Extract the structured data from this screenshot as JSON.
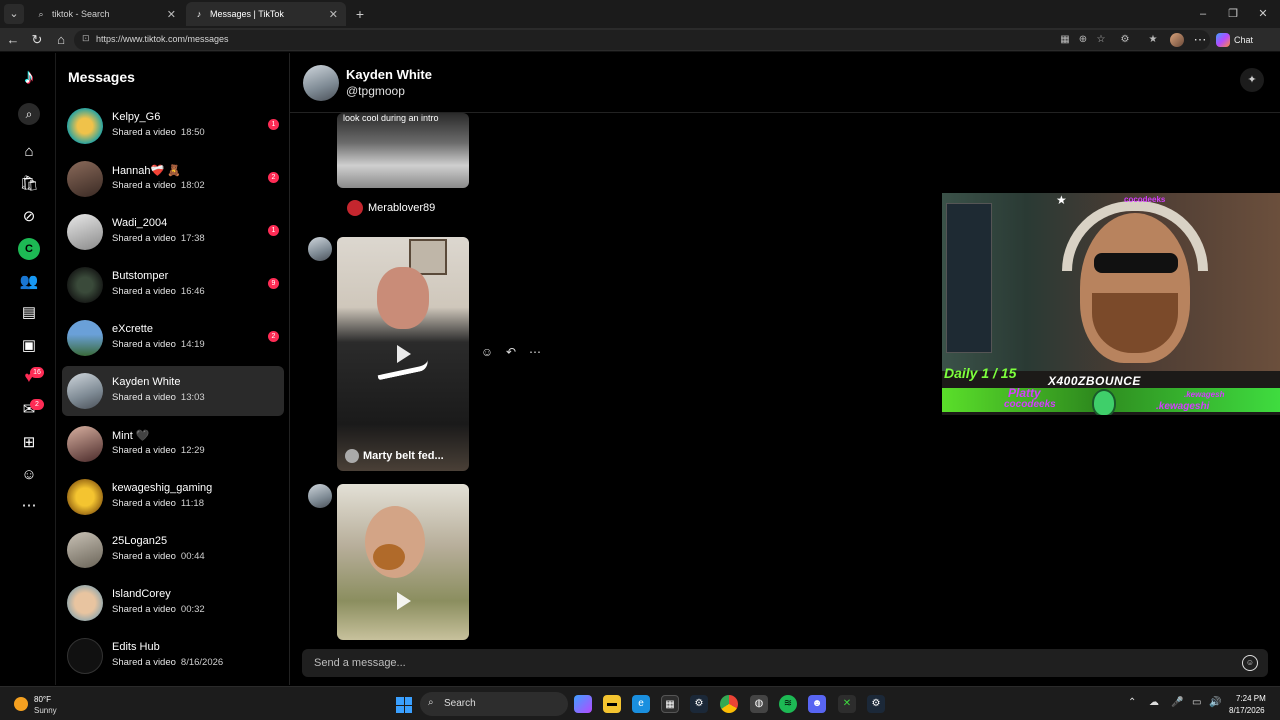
{
  "browser": {
    "tabs": [
      {
        "label": "tiktok - Search",
        "favicon": "search-icon"
      },
      {
        "label": "Messages | TikTok",
        "favicon": "tiktok-icon"
      }
    ],
    "url": "https://www.tiktok.com/messages",
    "chat_label": "Chat"
  },
  "rail": {
    "badges": {
      "activity": "16",
      "inbox": "2"
    }
  },
  "messages": {
    "title": "Messages",
    "conversations": [
      {
        "name": "Kelpy_G6",
        "preview": "Shared a video",
        "time": "18:50",
        "unread": "1"
      },
      {
        "name": "Hannah❤️‍🩹 🧸",
        "preview": "Shared a video",
        "time": "18:02",
        "unread": "2"
      },
      {
        "name": "Wadi_2004",
        "preview": "Shared a video",
        "time": "17:38",
        "unread": "1"
      },
      {
        "name": "Butstomper",
        "preview": "Shared a video",
        "time": "16:46",
        "unread": "9"
      },
      {
        "name": "eXcrette",
        "preview": "Shared a video",
        "time": "14:19",
        "unread": "2"
      },
      {
        "name": "Kayden White",
        "preview": "Shared a video",
        "time": "13:03",
        "unread": ""
      },
      {
        "name": "Mint 🖤",
        "preview": "Shared a video",
        "time": "12:29",
        "unread": ""
      },
      {
        "name": "kewageshig_gaming",
        "preview": "Shared a video",
        "time": "11:18",
        "unread": ""
      },
      {
        "name": "25Logan25",
        "preview": "Shared a video",
        "time": "00:44",
        "unread": ""
      },
      {
        "name": "IslandCorey",
        "preview": "Shared a video",
        "time": "00:32",
        "unread": ""
      },
      {
        "name": "Edits Hub",
        "preview": "Shared a video",
        "time": "8/16/2026",
        "unread": ""
      }
    ]
  },
  "chat": {
    "name": "Kayden White",
    "handle": "@tpgmoop",
    "video1_caption": "look cool during an intro",
    "video1_author": "Merablover89",
    "video2_author": "Marty belt fed...",
    "composer_placeholder": "Send a message..."
  },
  "overlay": {
    "top_name": "cocodeeks",
    "daily": "Daily 1 / 15",
    "streamer": "X400ZBOUNCE",
    "sub1": "Platty",
    "sub2": "cocodeeks",
    "kew1": ".kewagesh",
    "kew2": ".kewageshi"
  },
  "taskbar": {
    "temp": "80°F",
    "condition": "Sunny",
    "search": "Search",
    "time": "7:24 PM",
    "date": "8/17/2026"
  },
  "colors": {
    "accent": "#fe2c55",
    "tiktok_cyan": "#25f4ee",
    "live_green": "#1db954"
  }
}
